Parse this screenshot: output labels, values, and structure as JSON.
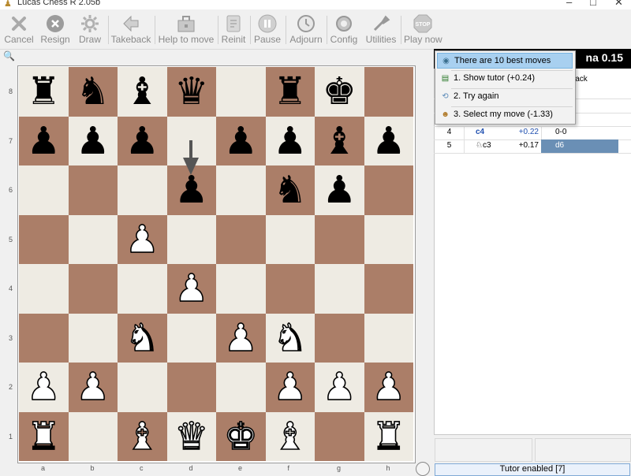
{
  "window": {
    "title": "Lucas Chess R 2.05b",
    "minimize_glyph": "–",
    "maximize_glyph": "□",
    "close_glyph": "✕"
  },
  "toolbar": [
    {
      "label": "Cancel",
      "icon": "cancel-icon"
    },
    {
      "label": "Resign",
      "icon": "resign-icon"
    },
    {
      "label": "Draw",
      "icon": "draw-icon"
    },
    {
      "label": "Takeback",
      "icon": "takeback-icon"
    },
    {
      "label": "Help to move",
      "icon": "help-to-move-icon"
    },
    {
      "label": "Reinit",
      "icon": "reinit-icon"
    },
    {
      "label": "Pause",
      "icon": "pause-icon"
    },
    {
      "label": "Adjourn",
      "icon": "adjourn-icon"
    },
    {
      "label": "Config",
      "icon": "config-icon"
    },
    {
      "label": "Utilities",
      "icon": "utilities-icon"
    },
    {
      "label": "Play now",
      "icon": "play-now-icon"
    }
  ],
  "board": {
    "ranks": [
      "8",
      "7",
      "6",
      "5",
      "4",
      "3",
      "2",
      "1"
    ],
    "files": [
      "a",
      "b",
      "c",
      "d",
      "e",
      "f",
      "g",
      "h"
    ],
    "rows": [
      [
        "bR",
        "bN",
        "bB",
        "bQ",
        "",
        "bR",
        "bK",
        ""
      ],
      [
        "bP",
        "bP",
        "bP",
        "",
        "bP",
        "bP",
        "bB",
        "bP"
      ],
      [
        "",
        "",
        "",
        "bP",
        "",
        "bN",
        "bP",
        ""
      ],
      [
        "",
        "",
        "wP",
        "",
        "",
        "",
        "",
        ""
      ],
      [
        "",
        "",
        "",
        "wP",
        "",
        "",
        "",
        ""
      ],
      [
        "",
        "",
        "wN",
        "",
        "wP",
        "wN",
        "",
        ""
      ],
      [
        "wP",
        "wP",
        "",
        "",
        "",
        "wP",
        "wP",
        "wP"
      ],
      [
        "wR",
        "",
        "wB",
        "wQ",
        "wK",
        "wB",
        "",
        "wR"
      ]
    ],
    "hint_arrow": "d7 → d6"
  },
  "engine_header": {
    "text": "na 0.15"
  },
  "moves_panel": {
    "header_partial": "lack",
    "rows": [
      {
        "num": "4",
        "white": "c4",
        "eval": "+0.22",
        "black": "0-0",
        "selected": false
      },
      {
        "num": "5",
        "white": "♘c3",
        "eval": "+0.17",
        "black": "d6",
        "selected": true
      }
    ]
  },
  "tutor_menu": {
    "items": [
      {
        "icon": "target-icon",
        "label": "There are 10 best moves",
        "highlighted": true
      },
      {
        "icon": "tutor-icon",
        "label": "1. Show tutor (+0.24)",
        "highlighted": false
      },
      {
        "icon": "retry-icon",
        "label": "2. Try again",
        "highlighted": false
      },
      {
        "icon": "user-move-icon",
        "label": "3. Select my move (-1.33)",
        "highlighted": false
      }
    ]
  },
  "status_bar": {
    "text": "Tutor enabled [7]"
  },
  "colors": {
    "light_square": "#eeebe3",
    "dark_square": "#ab7e68",
    "selection": "#6a8fb5",
    "highlight": "#a8d0f0"
  }
}
